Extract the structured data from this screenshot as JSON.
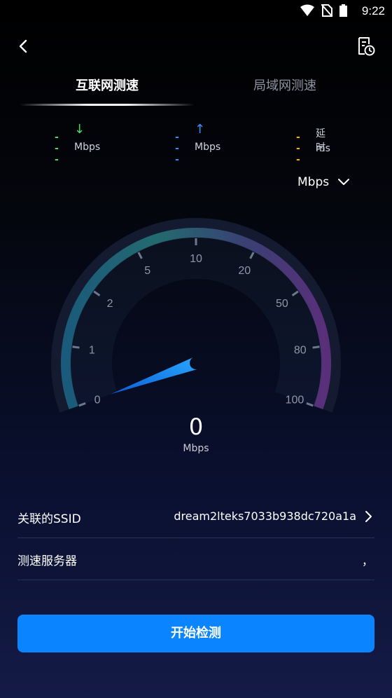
{
  "status_bar": {
    "time": "9:22",
    "icons": [
      "wifi-icon",
      "no-sim-icon",
      "battery-icon"
    ]
  },
  "top_bar": {
    "back_icon": "chevron-left-icon",
    "history_icon": "history-report-icon"
  },
  "tabs": [
    {
      "label": "互联网测速",
      "active": true
    },
    {
      "label": "局域网测速",
      "active": false
    }
  ],
  "metrics": {
    "download": {
      "value": "---",
      "arrow": "↓",
      "unit": "Mbps",
      "color": "#4cd964"
    },
    "upload": {
      "value": "---",
      "arrow": "↑",
      "unit": "Mbps",
      "color": "#3a8dff"
    },
    "latency": {
      "value": "---",
      "label": "延时",
      "unit": "ms",
      "color": "#f5b400"
    }
  },
  "unit_selector": {
    "selected": "Mbps"
  },
  "gauge": {
    "scale_labels": [
      "0",
      "1",
      "2",
      "5",
      "10",
      "20",
      "50",
      "80",
      "100"
    ],
    "current_value": "0",
    "unit": "Mbps",
    "needle_value": 0
  },
  "info": {
    "ssid_label": "关联的SSID",
    "ssid_value": "dream2lteks7033b938dc720a1a",
    "server_label": "测速服务器",
    "server_value": "，"
  },
  "start_button": {
    "label": "开始检测"
  }
}
